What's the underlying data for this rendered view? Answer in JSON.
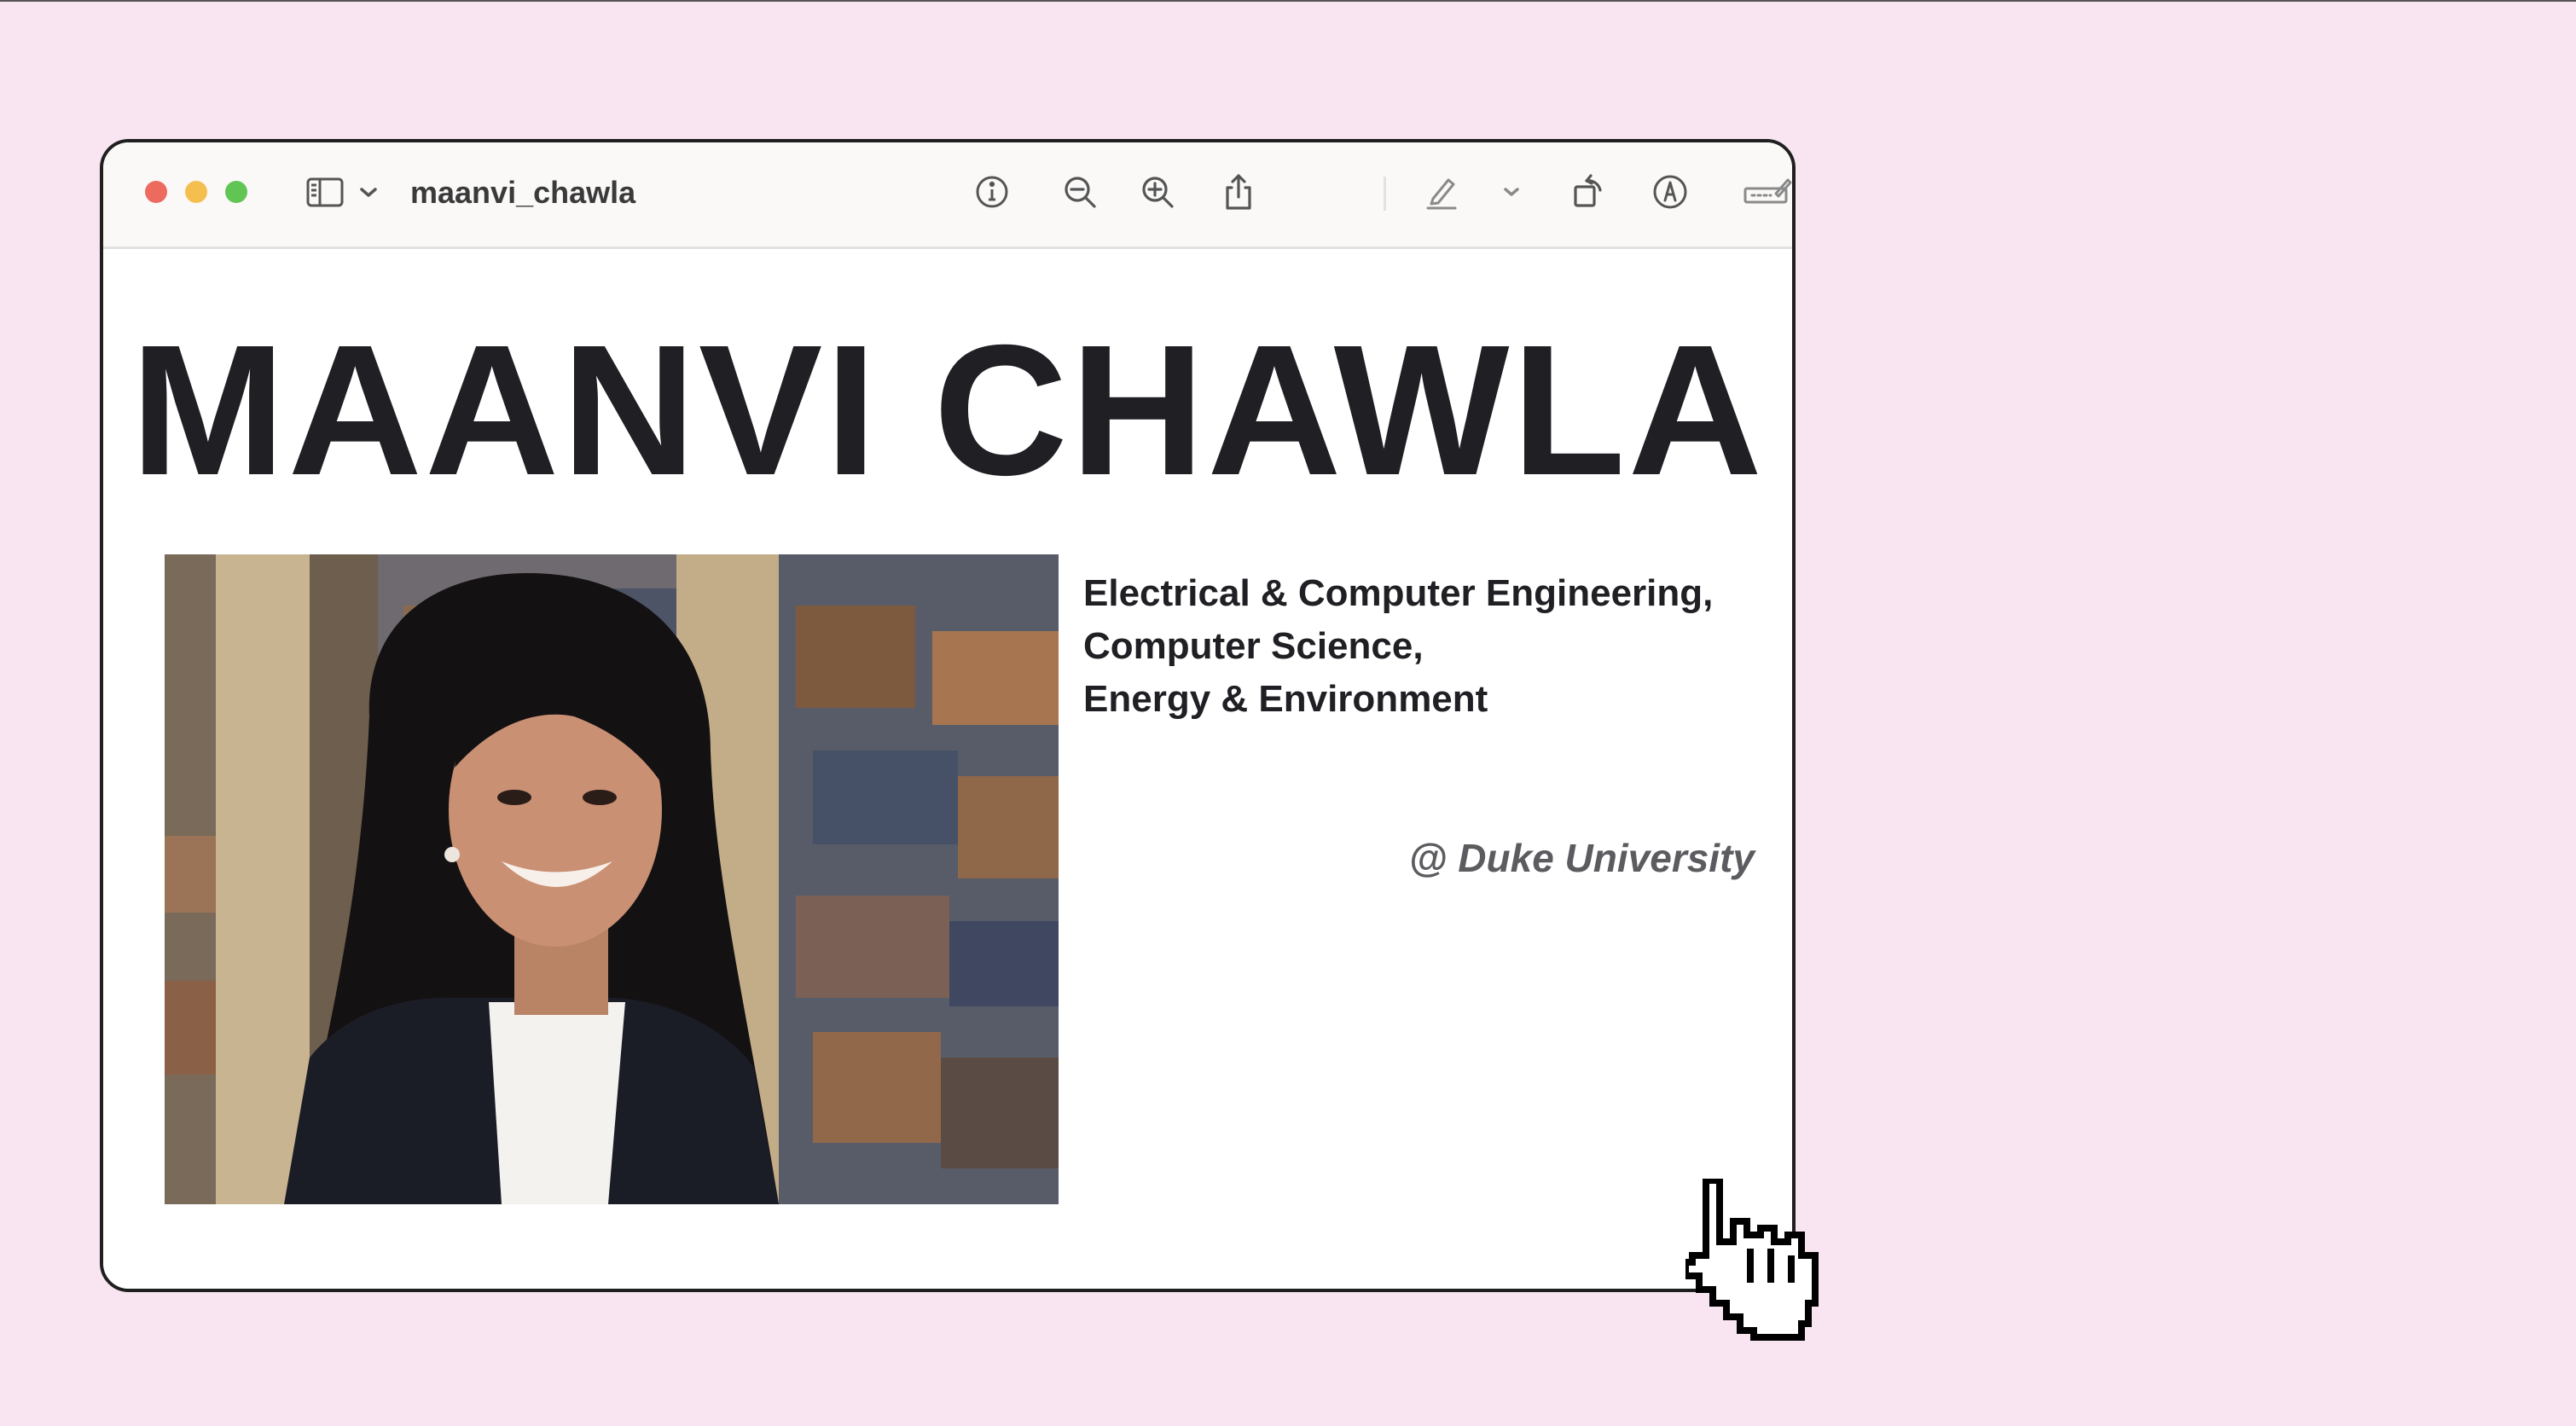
{
  "window": {
    "title": "maanvi_chawla"
  },
  "toolbar": {
    "icons": [
      "sidebar-toggle-icon",
      "chevron-down-icon",
      "info-icon",
      "zoom-out-icon",
      "zoom-in-icon",
      "share-icon",
      "highlight-pen-icon",
      "chevron-down-icon",
      "rotate-icon",
      "markup-icon",
      "form-fill-icon",
      "search-icon"
    ]
  },
  "page": {
    "name": "MAANVI CHAWLA",
    "majors": [
      "Electrical & Computer Engineering,",
      "Computer Science,",
      "Energy & Environment"
    ],
    "university": "@ Duke University"
  },
  "colors": {
    "background": "#f9e4f1",
    "window_border": "#1f1f1f",
    "heading_text": "#1f1f24",
    "university_text": "#5c5c60",
    "traffic_red": "#ed6a5e",
    "traffic_yellow": "#f5bf4f",
    "traffic_green": "#61c554"
  }
}
